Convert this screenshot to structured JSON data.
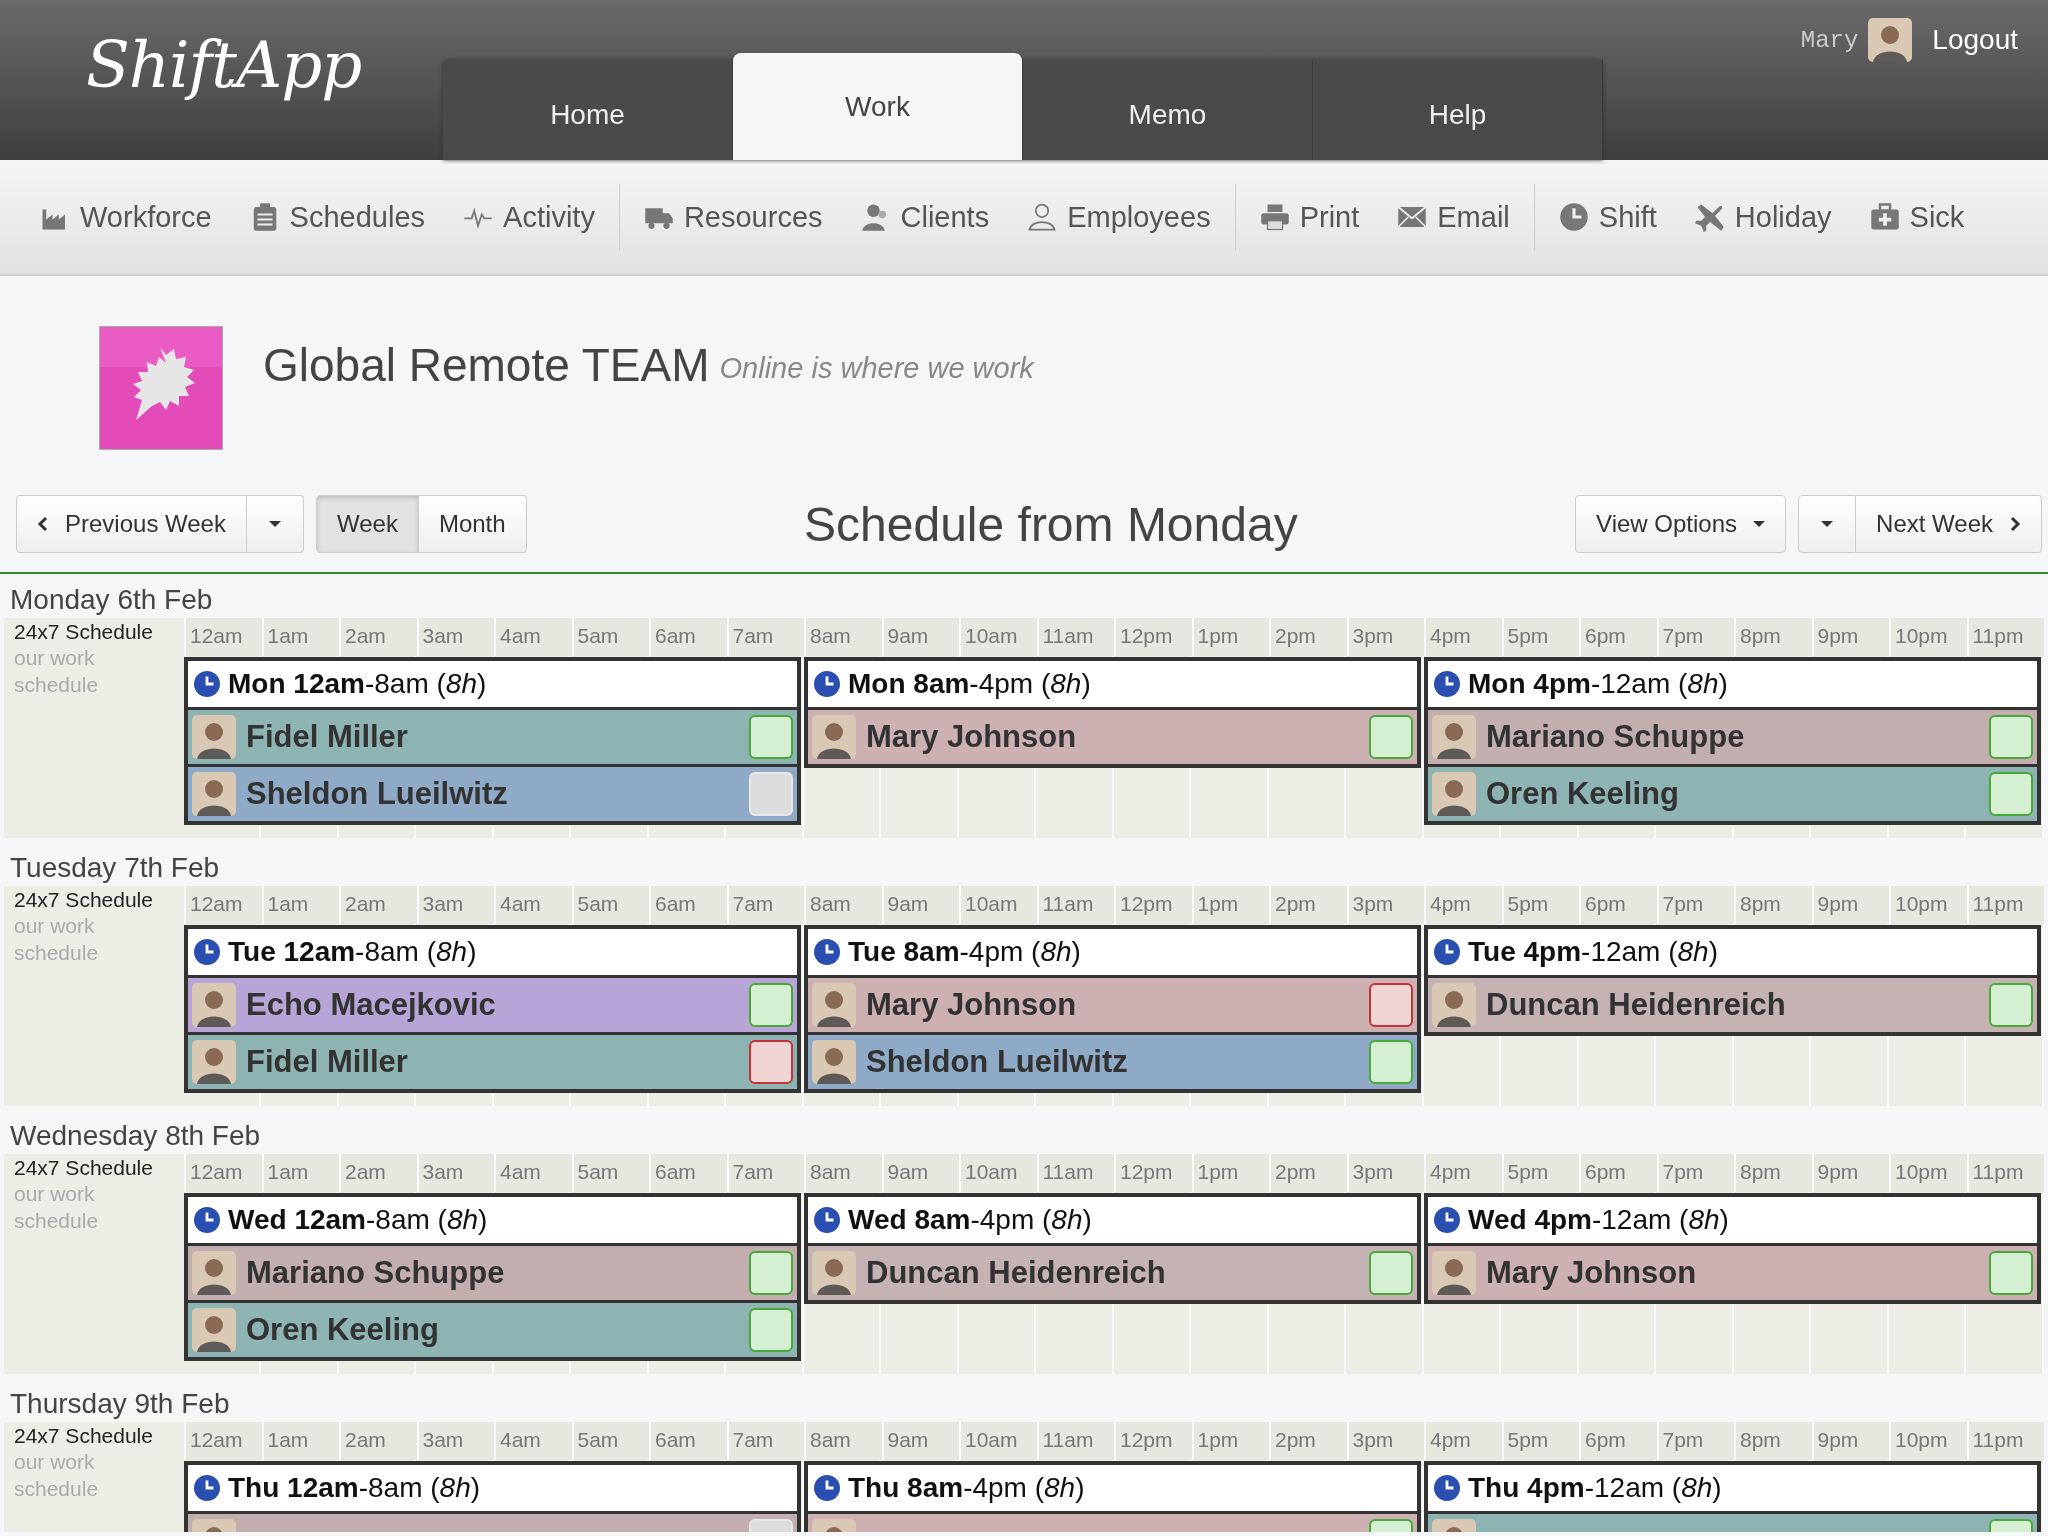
{
  "app": {
    "logo": "ShiftApp",
    "user": "Mary",
    "logout": "Logout"
  },
  "tabs": [
    {
      "label": "Home",
      "selected": false
    },
    {
      "label": "Work",
      "selected": true
    },
    {
      "label": "Memo",
      "selected": false
    },
    {
      "label": "Help",
      "selected": false
    }
  ],
  "toolbar": {
    "groups": [
      [
        "Workforce",
        "Schedules",
        "Activity"
      ],
      [
        "Resources",
        "Clients",
        "Employees"
      ],
      [
        "Print",
        "Email"
      ],
      [
        "Shift",
        "Holiday",
        "Sick"
      ]
    ]
  },
  "team": {
    "kind": "picture",
    "name": "Global Remote TEAM",
    "tagline": "Online is where we work"
  },
  "controls": {
    "previous": "Previous Week",
    "views": [
      {
        "label": "Week",
        "selected": true
      },
      {
        "label": "Month",
        "selected": false
      }
    ],
    "title": "Schedule from Monday",
    "options": "View Options",
    "next": "Next Week"
  },
  "days": [
    {
      "label": "Monday 6th Feb",
      "schedule": "24x7 Schedule",
      "description": "our work schedule",
      "hours": [
        "12am",
        "1am",
        "2am",
        "3am",
        "4am",
        "5am",
        "6am",
        "7am",
        "8am",
        "9am",
        "10am",
        "11am",
        "12pm",
        "1pm",
        "2pm",
        "3pm",
        "4pm",
        "5pm",
        "6pm",
        "7pm",
        "8pm",
        "9pm",
        "10pm",
        "11pm"
      ],
      "shifts": [
        {
          "title": "**Mon 12am**-8am (*8h*)",
          "assignments": [
            {
              "name": "Fidel Miller",
              "color": "#8db3b2",
              "kind": "approved"
            },
            {
              "name": "Sheldon Lueilwitz",
              "color": "#8eaac6",
              "kind": "pending"
            }
          ]
        },
        {
          "title": "**Mon 8am**-4pm (*8h*)",
          "assignments": [
            {
              "name": "Mary Johnson",
              "color": "#cdb0b1",
              "kind": "approved"
            }
          ]
        },
        {
          "title": "**Mon 4pm**-12am (*8h*)",
          "assignments": [
            {
              "name": "Mariano Schuppe",
              "color": "#c2aeae",
              "kind": "approved"
            },
            {
              "name": "Oren Keeling",
              "color": "#8db3b2",
              "kind": "approved"
            }
          ]
        }
      ]
    },
    {
      "label": "Tuesday 7th Feb",
      "schedule": "24x7 Schedule",
      "description": "our work schedule",
      "hours": [
        "12am",
        "1am",
        "2am",
        "3am",
        "4am",
        "5am",
        "6am",
        "7am",
        "8am",
        "9am",
        "10am",
        "11am",
        "12pm",
        "1pm",
        "2pm",
        "3pm",
        "4pm",
        "5pm",
        "6pm",
        "7pm",
        "8pm",
        "9pm",
        "10pm",
        "11pm"
      ],
      "shifts": [
        {
          "title": "**Tue 12am**-8am (*8h*)",
          "assignments": [
            {
              "name": "Echo Macejkovic",
              "color": "#b6a5d6",
              "kind": "approved"
            },
            {
              "name": "Fidel Miller",
              "color": "#8db3b2",
              "kind": "rejected"
            }
          ]
        },
        {
          "title": "**Tue 8am**-4pm (*8h*)",
          "assignments": [
            {
              "name": "Mary Johnson",
              "color": "#cdb0b1",
              "kind": "rejected"
            },
            {
              "name": "Sheldon Lueilwitz",
              "color": "#8eaac6",
              "kind": "approved"
            }
          ]
        },
        {
          "title": "**Tue 4pm**-12am (*8h*)",
          "assignments": [
            {
              "name": "Duncan Heidenreich",
              "color": "#c5b2b2",
              "kind": "approved"
            }
          ]
        }
      ]
    },
    {
      "label": "Wednesday 8th Feb",
      "schedule": "24x7 Schedule",
      "description": "our work schedule",
      "hours": [
        "12am",
        "1am",
        "2am",
        "3am",
        "4am",
        "5am",
        "6am",
        "7am",
        "8am",
        "9am",
        "10am",
        "11am",
        "12pm",
        "1pm",
        "2pm",
        "3pm",
        "4pm",
        "5pm",
        "6pm",
        "7pm",
        "8pm",
        "9pm",
        "10pm",
        "11pm"
      ],
      "shifts": [
        {
          "title": "**Wed 12am**-8am (*8h*)",
          "assignments": [
            {
              "name": "Mariano Schuppe",
              "color": "#c2aeae",
              "kind": "approved"
            },
            {
              "name": "Oren Keeling",
              "color": "#8db3b2",
              "kind": "approved"
            }
          ]
        },
        {
          "title": "**Wed 8am**-4pm (*8h*)",
          "assignments": [
            {
              "name": "Duncan Heidenreich",
              "color": "#c5b2b2",
              "kind": "approved"
            }
          ]
        },
        {
          "title": "**Wed 4pm**-12am (*8h*)",
          "assignments": [
            {
              "name": "Mary Johnson",
              "color": "#cdb0b1",
              "kind": "approved"
            }
          ]
        }
      ]
    },
    {
      "label": "Thursday 9th Feb",
      "schedule": "24x7 Schedule",
      "description": "our work schedule",
      "hours": [
        "12am",
        "1am",
        "2am",
        "3am",
        "4am",
        "5am",
        "6am",
        "7am",
        "8am",
        "9am",
        "10am",
        "11am",
        "12pm",
        "1pm",
        "2pm",
        "3pm",
        "4pm",
        "5pm",
        "6pm",
        "7pm",
        "8pm",
        "9pm",
        "10pm",
        "11pm"
      ],
      "shifts": [
        {
          "title": "**Thu 12am**-8am (*8h*)",
          "assignments": [
            {
              "color": "#c2aeae",
              "kind": "pending"
            }
          ]
        },
        {
          "title": "**Thu 8am**-4pm (*8h*)",
          "assignments": [
            {
              "color": "#cdb0b1",
              "kind": "approved"
            }
          ]
        },
        {
          "title": "**Thu 4pm**-12am (*8h*)",
          "assignments": [
            {
              "color": "#8db3b2",
              "kind": "approved"
            }
          ]
        }
      ]
    }
  ]
}
